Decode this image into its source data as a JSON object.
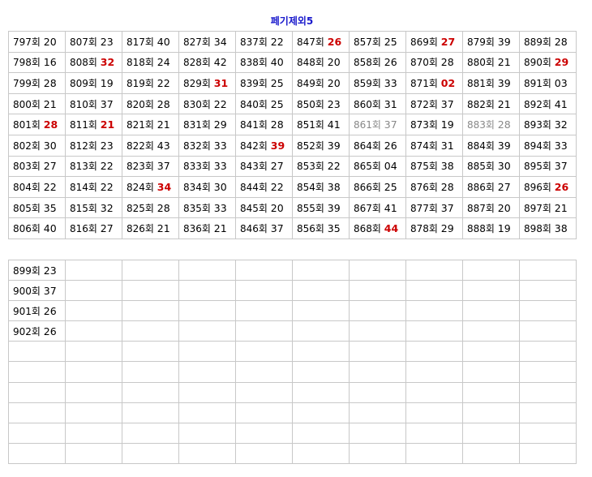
{
  "title": "페기제외5",
  "colors": {
    "title": "#1a1acc",
    "highlight": "#cc0000",
    "muted": "#888888",
    "border": "#c8c8c8"
  },
  "table1": [
    [
      {
        "label": "797회",
        "value": "20"
      },
      {
        "label": "807회",
        "value": "23"
      },
      {
        "label": "817회",
        "value": "40"
      },
      {
        "label": "827회",
        "value": "34"
      },
      {
        "label": "837회",
        "value": "22"
      },
      {
        "label": "847회",
        "value": "26",
        "style": "red"
      },
      {
        "label": "857회",
        "value": "25"
      },
      {
        "label": "869회",
        "value": "27",
        "style": "red"
      },
      {
        "label": "879회",
        "value": "39"
      },
      {
        "label": "889회",
        "value": "28"
      }
    ],
    [
      {
        "label": "798회",
        "value": "16"
      },
      {
        "label": "808회",
        "value": "32",
        "style": "red"
      },
      {
        "label": "818회",
        "value": "24"
      },
      {
        "label": "828회",
        "value": "42"
      },
      {
        "label": "838회",
        "value": "40"
      },
      {
        "label": "848회",
        "value": "20"
      },
      {
        "label": "858회",
        "value": "26"
      },
      {
        "label": "870회",
        "value": "28"
      },
      {
        "label": "880회",
        "value": "21"
      },
      {
        "label": "890회",
        "value": "29",
        "style": "red"
      }
    ],
    [
      {
        "label": "799회",
        "value": "28"
      },
      {
        "label": "809회",
        "value": "19"
      },
      {
        "label": "819회",
        "value": "22"
      },
      {
        "label": "829회",
        "value": "31",
        "style": "red"
      },
      {
        "label": "839회",
        "value": "25"
      },
      {
        "label": "849회",
        "value": "20"
      },
      {
        "label": "859회",
        "value": "33"
      },
      {
        "label": "871회",
        "value": "02",
        "style": "red"
      },
      {
        "label": "881회",
        "value": "39"
      },
      {
        "label": "891회",
        "value": "03"
      }
    ],
    [
      {
        "label": "800회",
        "value": "21"
      },
      {
        "label": "810회",
        "value": "37"
      },
      {
        "label": "820회",
        "value": "28"
      },
      {
        "label": "830회",
        "value": "22"
      },
      {
        "label": "840회",
        "value": "25"
      },
      {
        "label": "850회",
        "value": "23"
      },
      {
        "label": "860회",
        "value": "31"
      },
      {
        "label": "872회",
        "value": "37"
      },
      {
        "label": "882회",
        "value": "21"
      },
      {
        "label": "892회",
        "value": "41"
      }
    ],
    [
      {
        "label": "801회",
        "value": "28",
        "style": "red"
      },
      {
        "label": "811회",
        "value": "21",
        "style": "red"
      },
      {
        "label": "821회",
        "value": "21"
      },
      {
        "label": "831회",
        "value": "29"
      },
      {
        "label": "841회",
        "value": "28"
      },
      {
        "label": "851회",
        "value": "41"
      },
      {
        "label": "861회",
        "value": "37",
        "style": "gray"
      },
      {
        "label": "873회",
        "value": "19"
      },
      {
        "label": "883회",
        "value": "28",
        "style": "gray"
      },
      {
        "label": "893회",
        "value": "32"
      }
    ],
    [
      {
        "label": "802회",
        "value": "30"
      },
      {
        "label": "812회",
        "value": "23"
      },
      {
        "label": "822회",
        "value": "43"
      },
      {
        "label": "832회",
        "value": "33"
      },
      {
        "label": "842회",
        "value": "39",
        "style": "red"
      },
      {
        "label": "852회",
        "value": "39"
      },
      {
        "label": "864회",
        "value": "26"
      },
      {
        "label": "874회",
        "value": "31"
      },
      {
        "label": "884회",
        "value": "39"
      },
      {
        "label": "894회",
        "value": "33"
      }
    ],
    [
      {
        "label": "803회",
        "value": "27"
      },
      {
        "label": "813회",
        "value": "22"
      },
      {
        "label": "823회",
        "value": "37"
      },
      {
        "label": "833회",
        "value": "33"
      },
      {
        "label": "843회",
        "value": "27"
      },
      {
        "label": "853회",
        "value": "22"
      },
      {
        "label": "865회",
        "value": "04"
      },
      {
        "label": "875회",
        "value": "38"
      },
      {
        "label": "885회",
        "value": "30"
      },
      {
        "label": "895회",
        "value": "37"
      }
    ],
    [
      {
        "label": "804회",
        "value": "22"
      },
      {
        "label": "814회",
        "value": "22"
      },
      {
        "label": "824회",
        "value": "34",
        "style": "red"
      },
      {
        "label": "834회",
        "value": "30"
      },
      {
        "label": "844회",
        "value": "22"
      },
      {
        "label": "854회",
        "value": "38"
      },
      {
        "label": "866회",
        "value": "25"
      },
      {
        "label": "876회",
        "value": "28"
      },
      {
        "label": "886회",
        "value": "27"
      },
      {
        "label": "896회",
        "value": "26",
        "style": "red"
      }
    ],
    [
      {
        "label": "805회",
        "value": "35"
      },
      {
        "label": "815회",
        "value": "32"
      },
      {
        "label": "825회",
        "value": "28"
      },
      {
        "label": "835회",
        "value": "33"
      },
      {
        "label": "845회",
        "value": "20"
      },
      {
        "label": "855회",
        "value": "39"
      },
      {
        "label": "867회",
        "value": "41"
      },
      {
        "label": "877회",
        "value": "37"
      },
      {
        "label": "887회",
        "value": "20"
      },
      {
        "label": "897회",
        "value": "21"
      }
    ],
    [
      {
        "label": "806회",
        "value": "40"
      },
      {
        "label": "816회",
        "value": "27"
      },
      {
        "label": "826회",
        "value": "21"
      },
      {
        "label": "836회",
        "value": "21"
      },
      {
        "label": "846회",
        "value": "37"
      },
      {
        "label": "856회",
        "value": "35"
      },
      {
        "label": "868회",
        "value": "44",
        "style": "red"
      },
      {
        "label": "878회",
        "value": "29"
      },
      {
        "label": "888회",
        "value": "19"
      },
      {
        "label": "898회",
        "value": "38"
      }
    ]
  ],
  "table2": [
    [
      {
        "label": "899회",
        "value": "23"
      },
      {},
      {},
      {},
      {},
      {},
      {},
      {},
      {},
      {}
    ],
    [
      {
        "label": "900회",
        "value": "37"
      },
      {},
      {},
      {},
      {},
      {},
      {},
      {},
      {},
      {}
    ],
    [
      {
        "label": "901회",
        "value": "26"
      },
      {},
      {},
      {},
      {},
      {},
      {},
      {},
      {},
      {}
    ],
    [
      {
        "label": "902회",
        "value": "26"
      },
      {},
      {},
      {},
      {},
      {},
      {},
      {},
      {},
      {}
    ],
    [
      {},
      {},
      {},
      {},
      {},
      {},
      {},
      {},
      {},
      {}
    ],
    [
      {},
      {},
      {},
      {},
      {},
      {},
      {},
      {},
      {},
      {}
    ],
    [
      {},
      {},
      {},
      {},
      {},
      {},
      {},
      {},
      {},
      {}
    ],
    [
      {},
      {},
      {},
      {},
      {},
      {},
      {},
      {},
      {},
      {}
    ],
    [
      {},
      {},
      {},
      {},
      {},
      {},
      {},
      {},
      {},
      {}
    ],
    [
      {},
      {},
      {},
      {},
      {},
      {},
      {},
      {},
      {},
      {}
    ]
  ]
}
